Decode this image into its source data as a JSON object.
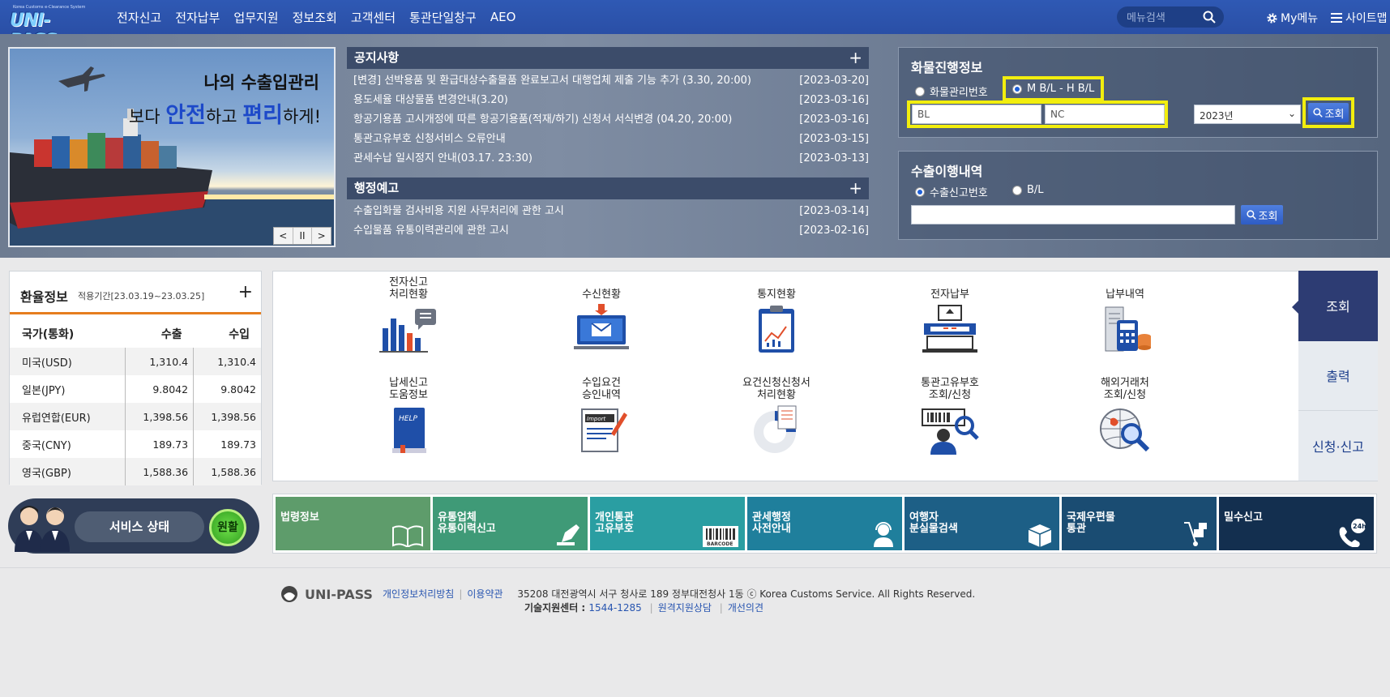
{
  "header": {
    "logo_tagline": "Korea Customs e-Clearance System",
    "logo_text": "UNI-PASS",
    "nav": [
      "전자신고",
      "전자납부",
      "업무지원",
      "정보조회",
      "고객센터",
      "통관단일창구",
      "AEO"
    ],
    "search_placeholder": "메뉴검색",
    "my_menu": "My메뉴",
    "sitemap": "사이트맵"
  },
  "banner": {
    "line1": "나의 수출입관리",
    "line2_pre": "보다 ",
    "line2_em1": "안전",
    "line2_mid": "하고 ",
    "line2_em2": "편리",
    "line2_post": "하게!",
    "controls": [
      "<",
      "II",
      ">"
    ]
  },
  "notices": {
    "title": "공지사항",
    "plus": "+",
    "items": [
      {
        "text": "[변경] 선박용품 및 환급대상수출물품 완료보고서 대행업체 제출 기능 추가 (3.30, 20:00)",
        "date": "[2023-03-20]"
      },
      {
        "text": "용도세율 대상물품 변경안내(3.20)",
        "date": "[2023-03-16]"
      },
      {
        "text": "항공기용품 고시개정에 따른 항공기용품(적재/하기) 신청서 서식변경 (04.20, 20:00)",
        "date": "[2023-03-16]"
      },
      {
        "text": "통관고유부호 신청서비스 오류안내",
        "date": "[2023-03-15]"
      },
      {
        "text": "관세수납 일시정지 안내(03.17. 23:30)",
        "date": "[2023-03-13]"
      }
    ]
  },
  "admin_notices": {
    "title": "행정예고",
    "plus": "+",
    "items": [
      {
        "text": "수출입화물 검사비용 지원 사무처리에 관한 고시",
        "date": "[2023-03-14]"
      },
      {
        "text": "수입물품 유통이력관리에 관한 고시",
        "date": "[2023-02-16]"
      }
    ]
  },
  "cargo": {
    "title": "화물진행정보",
    "radio1": "화물관리번호",
    "radio2": "M B/L - H B/L",
    "input1_value": "BL",
    "input2_value": "NC",
    "year": "2023년",
    "button": "조회"
  },
  "export": {
    "title": "수출이행내역",
    "radio1": "수출신고번호",
    "radio2": "B/L",
    "input_value": "",
    "button": "조회"
  },
  "fx": {
    "title": "환율정보",
    "period": "적용기간[23.03.19~23.03.25]",
    "plus": "+",
    "headers": [
      "국가(통화)",
      "수출",
      "수입"
    ],
    "rows": [
      [
        "미국(USD)",
        "1,310.4",
        "1,310.4"
      ],
      [
        "일본(JPY)",
        "9.8042",
        "9.8042"
      ],
      [
        "유럽연합(EUR)",
        "1,398.56",
        "1,398.56"
      ],
      [
        "중국(CNY)",
        "189.73",
        "189.73"
      ],
      [
        "영국(GBP)",
        "1,588.36",
        "1,588.36"
      ]
    ]
  },
  "status": {
    "label": "서비스 상태",
    "value": "원활"
  },
  "services": {
    "row1": [
      "전자신고\n처리현황",
      "수신현황",
      "통지현황",
      "전자납부",
      "납부내역"
    ],
    "row2": [
      "납세신고\n도움정보",
      "수입요건\n승인내역",
      "요건신청신청서\n처리현황",
      "통관고유부호\n조회/신청",
      "해외거래처\n조회/신청"
    ],
    "help_text": "HELP",
    "import_text": "Import"
  },
  "side_tabs": [
    "조회",
    "출력",
    "신청·신고"
  ],
  "quick": [
    {
      "label": "법령정보",
      "color": "#5e9c6b"
    },
    {
      "label": "유통업체\n유통이력신고",
      "color": "#3f9a77"
    },
    {
      "label": "개인통관\n고유부호",
      "color": "#2a9ea2"
    },
    {
      "label": "관세행정\n사전안내",
      "color": "#1f7f9c"
    },
    {
      "label": "여행자\n분실물검색",
      "color": "#1d5f86"
    },
    {
      "label": "국제우편물\n통관",
      "color": "#1a4c72"
    },
    {
      "label": "밀수신고",
      "color": "#132f4f"
    }
  ],
  "quick_badges": {
    "barcode": "BARCODE",
    "hours": "24h"
  },
  "footer": {
    "logo": "UNI-PASS",
    "privacy": "개인정보처리방침",
    "terms": "이용약관",
    "address": "35208 대전광역시 서구 청사로 189 정부대전청사 1동 ⓒ Korea Customs Service. All Rights Reserved.",
    "support_label": "기술지원센터 : ",
    "support_phone": "1544-1285",
    "remote": "원격지원상담",
    "improve": "개선의견"
  }
}
